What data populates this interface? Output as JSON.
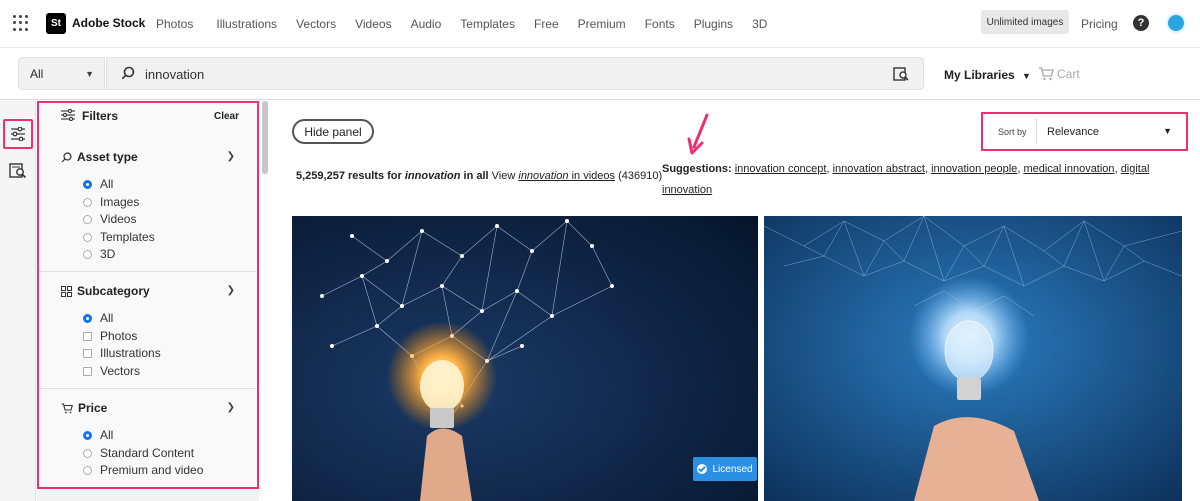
{
  "header": {
    "logo_text": "St",
    "brand": "Adobe Stock",
    "nav": [
      "Photos",
      "Illustrations",
      "Vectors",
      "Videos",
      "Audio",
      "Templates",
      "Free",
      "Premium",
      "Fonts",
      "Plugins",
      "3D"
    ],
    "unlimited": "Unlimited images",
    "pricing": "Pricing",
    "help": "?"
  },
  "search": {
    "scope": "All",
    "query": "innovation",
    "my_libraries": "My Libraries",
    "cart": "Cart"
  },
  "filters": {
    "title": "Filters",
    "clear": "Clear",
    "sections": [
      {
        "title": "Asset type",
        "control": "radio",
        "options": [
          "All",
          "Images",
          "Videos",
          "Templates",
          "3D"
        ],
        "selected": "All"
      },
      {
        "title": "Subcategory",
        "control": "mixed",
        "options": [
          "All",
          "Photos",
          "Illustrations",
          "Vectors"
        ],
        "selected": "All"
      },
      {
        "title": "Price",
        "control": "radio",
        "options": [
          "All",
          "Standard Content",
          "Premium and video"
        ],
        "selected": "All"
      }
    ]
  },
  "main": {
    "hide_panel": "Hide panel",
    "sort_label": "Sort by",
    "sort_value": "Relevance",
    "results_count": "5,259,257",
    "results_for": "results for",
    "results_query": "innovation",
    "results_in": "in all",
    "view_text": "View",
    "view_link_query": "innovation",
    "view_link_rest": "in videos",
    "view_count": "(436910)",
    "suggestions_label": "Suggestions:",
    "suggestions": [
      "innovation concept",
      "innovation abstract",
      "innovation people",
      "medical innovation",
      "digital innovation"
    ],
    "licensed": "Licensed"
  },
  "colors": {
    "highlight": "#ec2f6e",
    "accent": "#1473e6",
    "licensed": "#2b8fe4"
  }
}
